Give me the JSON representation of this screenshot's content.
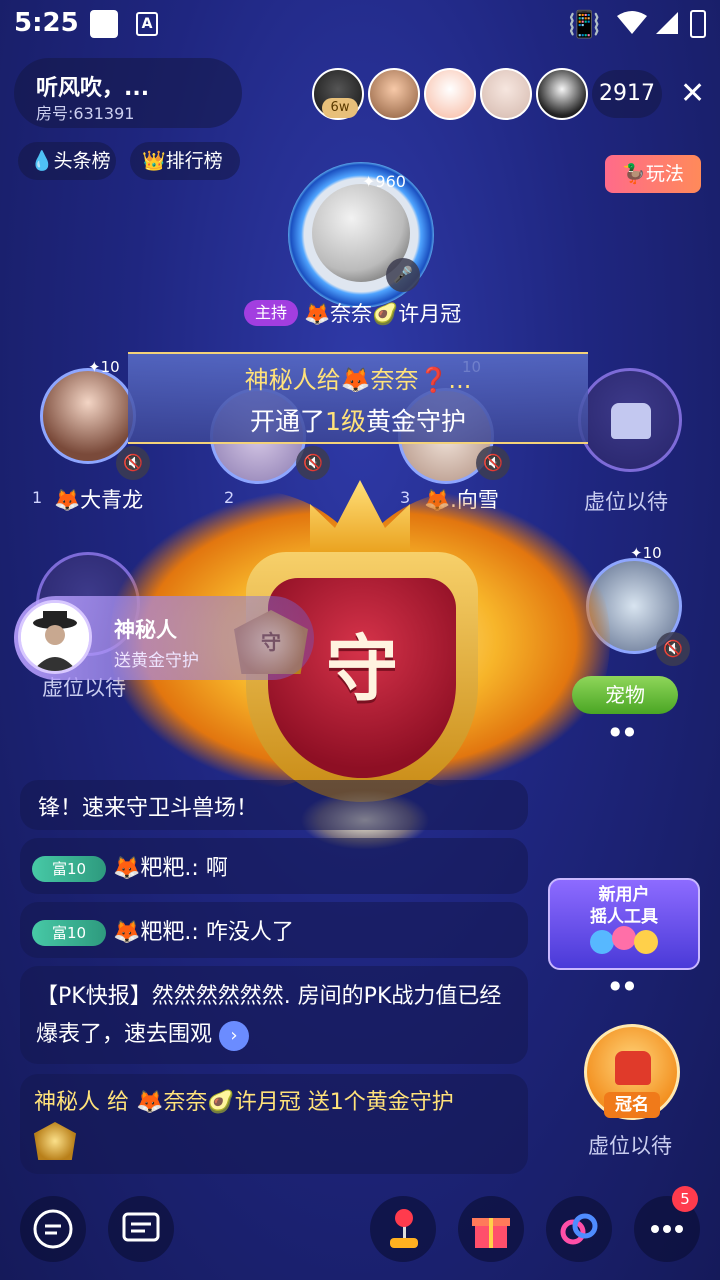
{
  "status_bar": {
    "time": "5:25",
    "a_label": "A"
  },
  "room": {
    "name": "听风吹，...",
    "id": "房号:631391"
  },
  "audience": {
    "badge": "6w",
    "count": "2917"
  },
  "chips": {
    "headlines": "头条榜",
    "ranking": "排行榜"
  },
  "play": {
    "label": "玩法"
  },
  "host": {
    "heat": "960",
    "tag": "主持",
    "name": "🦊奈奈🥑许月冠"
  },
  "banner": {
    "line1": "神秘人给🦊奈奈❓...",
    "line2_pre": "开通了",
    "line2_level": "1级",
    "line2_post": "黄金守护"
  },
  "seats": [
    {
      "num": "1",
      "name": "🦊大青龙",
      "heat": "10"
    },
    {
      "num": "2",
      "name": "🦊​...",
      "heat": ""
    },
    {
      "num": "3",
      "name": "🦊.向雪",
      "heat": "10"
    }
  ],
  "empty_seat_label": "虚位以待",
  "big_badge": {
    "char": "守",
    "small": "守"
  },
  "right_seat": {
    "heat": "10"
  },
  "sender": {
    "name": "神秘人",
    "sub": "送黄金守护"
  },
  "pet": {
    "label": "宠物"
  },
  "chat": {
    "m1": "锋！速来守卫斗兽场！",
    "m2_rich": "富10",
    "m2_name": "🦊粑粑.:",
    "m2_text": "啊",
    "m3_rich": "富10",
    "m3_name": "🦊粑粑.:",
    "m3_text": "咋没人了",
    "m4": "【PK快报】然然然然然然. 房间的PK战力值已经爆表了，速去围观",
    "m5": "神秘人 给 🦊奈奈🥑许月冠 送1个黄金守护"
  },
  "promo": {
    "line1": "新用户",
    "line2": "摇人工具"
  },
  "crown_seat": {
    "tag": "冠名",
    "label": "虚位以待"
  },
  "bottom": {
    "more_badge": "5"
  }
}
